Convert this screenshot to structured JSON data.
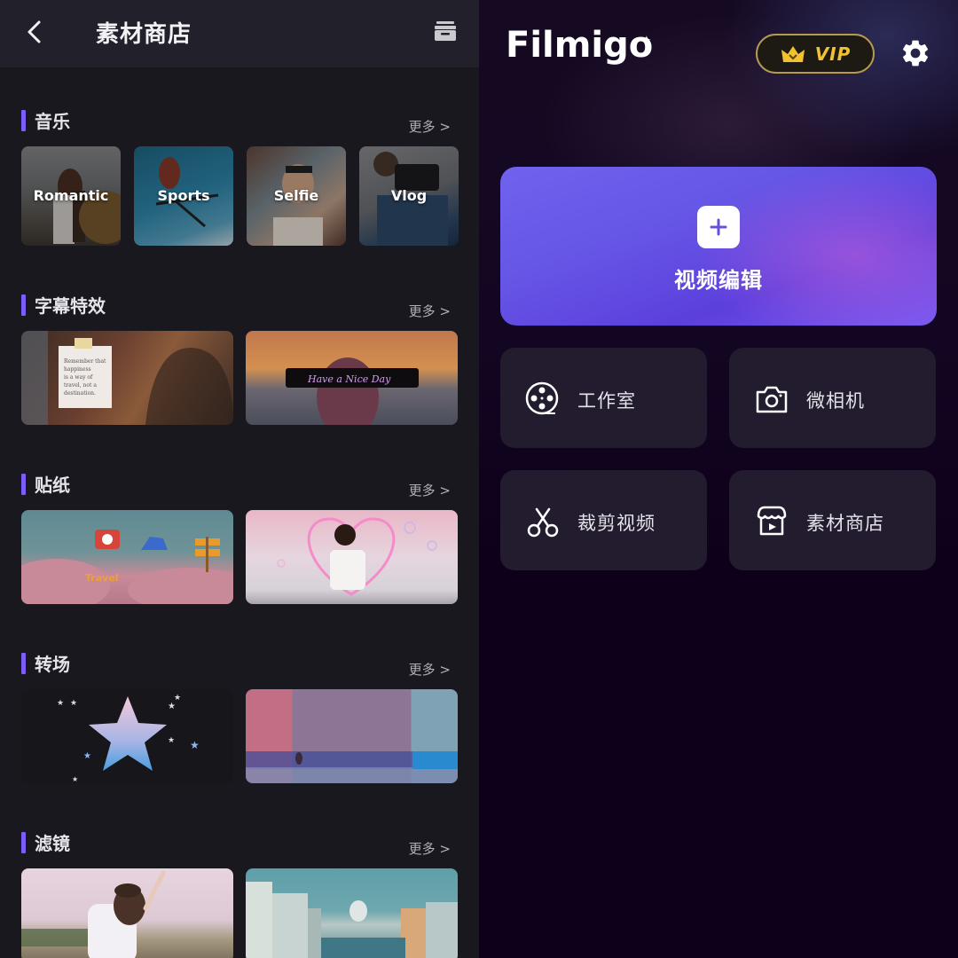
{
  "store": {
    "title": "素材商店",
    "back_icon": "chevron-left-icon",
    "archive_icon": "archive-box-icon",
    "more_label": "更多 >",
    "accent_color": "#7d5cf7",
    "sections": [
      {
        "title": "音乐",
        "items": [
          {
            "label": "Romantic"
          },
          {
            "label": "Sports"
          },
          {
            "label": "Selfie"
          },
          {
            "label": "Vlog"
          }
        ]
      },
      {
        "title": "字幕特效",
        "items": [
          {
            "caption": "Remember that happiness is a way of travel, not a destination."
          },
          {
            "caption": "Have a Nice Day"
          }
        ]
      },
      {
        "title": "贴纸",
        "items": [
          {
            "caption": "Travel"
          },
          {
            "caption": ""
          }
        ]
      },
      {
        "title": "转场",
        "items": [
          {
            "caption": ""
          },
          {
            "caption": ""
          }
        ]
      },
      {
        "title": "滤镜",
        "items": [
          {
            "caption": ""
          },
          {
            "caption": ""
          }
        ]
      }
    ]
  },
  "home": {
    "logo": "Filmigo",
    "vip_label": "VIP",
    "vip_color": "#f2c230",
    "settings_icon": "gear-icon",
    "primary_action": {
      "label": "视频编辑",
      "icon": "plus-icon"
    },
    "tools": [
      {
        "label": "工作室",
        "icon": "film-reel-icon"
      },
      {
        "label": "微相机",
        "icon": "camera-icon"
      },
      {
        "label": "裁剪视频",
        "icon": "scissors-icon"
      },
      {
        "label": "素材商店",
        "icon": "store-icon"
      }
    ]
  }
}
